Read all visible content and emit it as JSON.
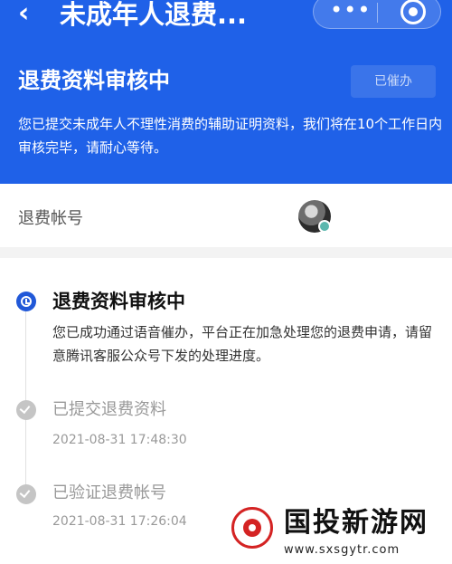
{
  "topbar": {
    "back_icon": "chevron-left-icon",
    "title": "未成年人退费...",
    "more_icon": "more-dots-icon",
    "more_glyph": "•••",
    "close_icon": "target-circle-icon"
  },
  "status": {
    "title": "退费资料审核中",
    "urge_button": "已催办",
    "description": "您已提交未成年人不理性消费的辅助证明资料，我们将在10个工作日内审核完毕，请耐心等待。"
  },
  "account": {
    "label": "退费帐号"
  },
  "timeline": {
    "current": {
      "title": "退费资料审核中",
      "description": "您已成功通过语音催办，平台正在加急处理您的退费申请，请留意腾讯客服公众号下发的处理进度。"
    },
    "steps": [
      {
        "title": "已提交退费资料",
        "time": "2021-08-31 17:48:30"
      },
      {
        "title": "已验证退费帐号",
        "time": "2021-08-31 17:26:04"
      }
    ]
  },
  "watermark": {
    "text": "国投新游网",
    "url": "www.sxsgytr.com"
  },
  "colors": {
    "header_blue": "#1f61e8",
    "timeline_active": "#2158d8",
    "timeline_done": "#c5c5c5",
    "watermark_red": "#d42323"
  }
}
